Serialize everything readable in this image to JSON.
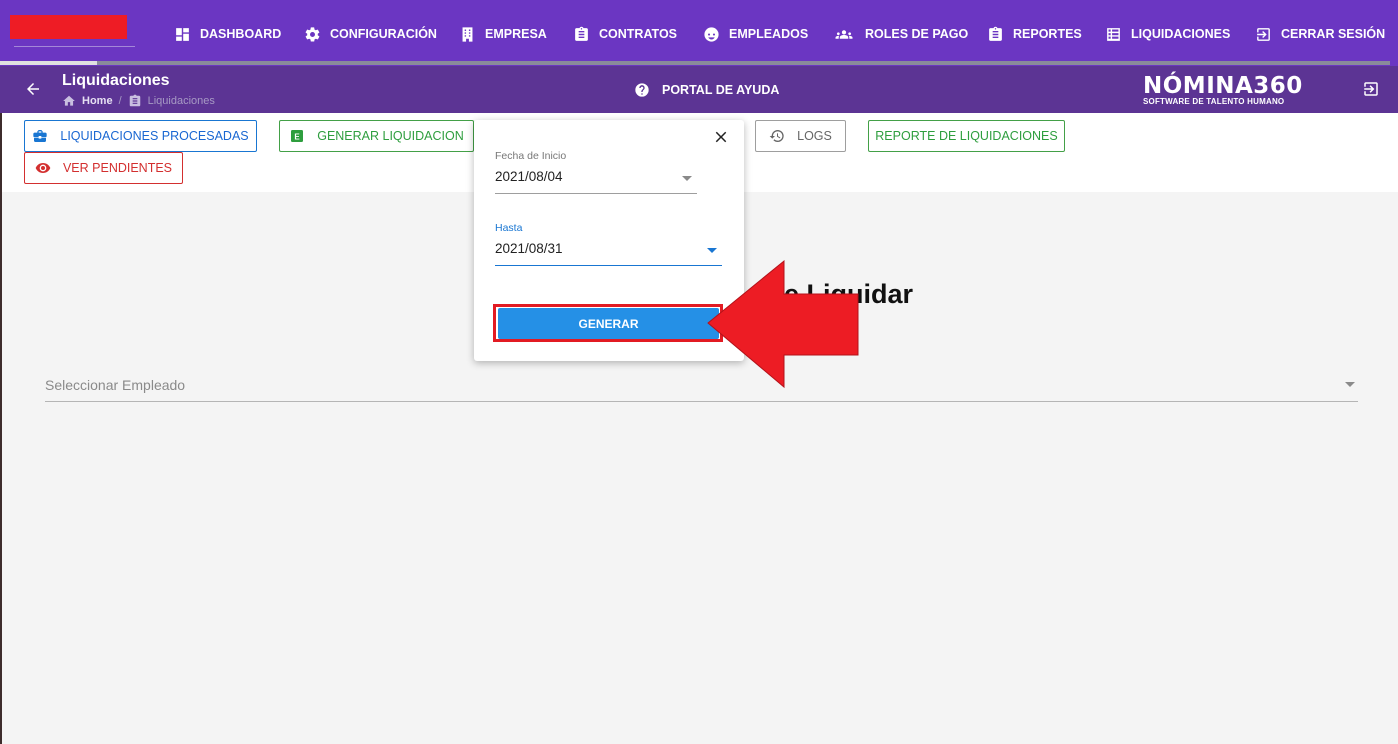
{
  "nav": {
    "items": [
      {
        "label": "DASHBOARD",
        "icon": "dashboard-icon"
      },
      {
        "label": "CONFIGURACIÓN",
        "icon": "gear-icon"
      },
      {
        "label": "EMPRESA",
        "icon": "building-icon"
      },
      {
        "label": "CONTRATOS",
        "icon": "clipboard-icon"
      },
      {
        "label": "EMPLEADOS",
        "icon": "face-icon"
      },
      {
        "label": "ROLES DE PAGO",
        "icon": "group-icon"
      },
      {
        "label": "REPORTES",
        "icon": "report-icon"
      },
      {
        "label": "LIQUIDACIONES",
        "icon": "list-icon"
      },
      {
        "label": "CERRAR SESIÓN",
        "icon": "logout-icon"
      }
    ],
    "progress": 0.07
  },
  "subheader": {
    "title": "Liquidaciones",
    "breadcrumb_home": "Home",
    "breadcrumb_sep": "/",
    "breadcrumb_current": "Liquidaciones",
    "help_label": "PORTAL DE AYUDA",
    "brand_name": "NÓMINA360",
    "brand_tagline": "SOFTWARE DE TALENTO HUMANO"
  },
  "actions": {
    "procesadas": "LIQUIDACIONES PROCESADAS",
    "generar": "GENERAR LIQUIDACION",
    "logs": "LOGS",
    "reporte": "REPORTE DE LIQUIDACIONES",
    "pendientes": "VER PENDIENTES"
  },
  "main": {
    "heading": "e Liquidar",
    "select_placeholder": "Seleccionar Empleado"
  },
  "popup": {
    "start_label": "Fecha de Inicio",
    "start_value": "2021/08/04",
    "end_label": "Hasta",
    "end_value": "2021/08/31",
    "generate_label": "GENERAR"
  },
  "colors": {
    "nav_bg": "#6b36c2",
    "subheader_bg": "#5c3494",
    "primary_blue": "#2590e6",
    "highlight_red": "#e21b23"
  }
}
